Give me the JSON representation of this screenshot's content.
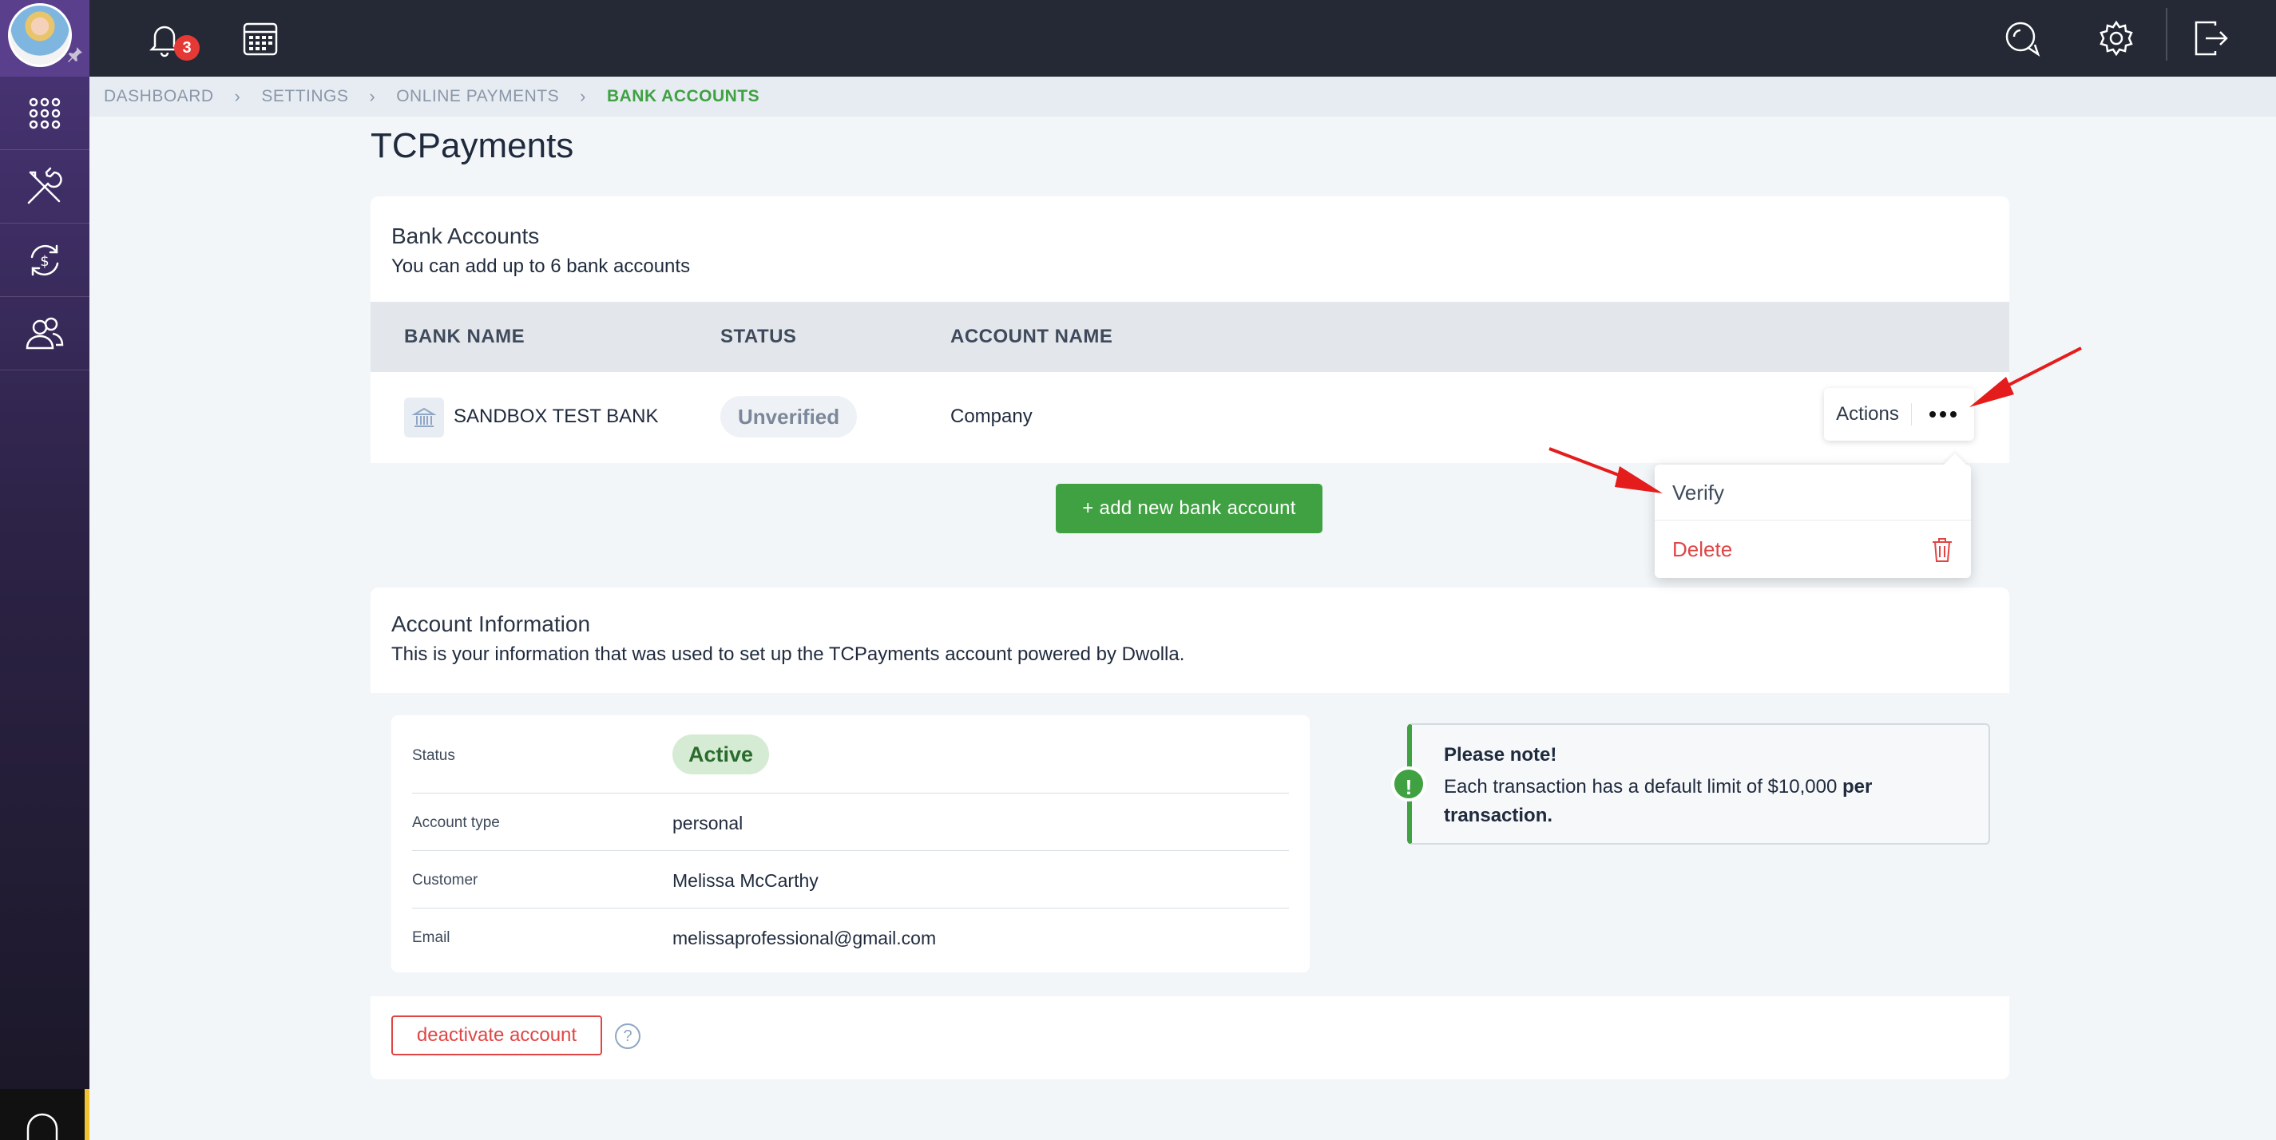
{
  "topbar": {
    "notification_count": "3"
  },
  "breadcrumb": [
    "DASHBOARD",
    "SETTINGS",
    "ONLINE PAYMENTS",
    "BANK ACCOUNTS"
  ],
  "page_title": "TCPayments",
  "bank_accounts": {
    "title": "Bank Accounts",
    "subtitle": "You can add up to 6 bank accounts",
    "columns": [
      "BANK NAME",
      "STATUS",
      "ACCOUNT NAME"
    ],
    "rows": [
      {
        "bank_name": "SANDBOX TEST BANK",
        "status": "Unverified",
        "account_name": "Company"
      }
    ],
    "actions_label": "Actions",
    "add_button": "+ add new bank account",
    "dropdown": {
      "verify": "Verify",
      "delete": "Delete"
    }
  },
  "account_info": {
    "title": "Account Information",
    "subtitle": "This is your information that was used to set up the TCPayments account powered by Dwolla.",
    "fields": [
      {
        "key": "Status",
        "value": "Active"
      },
      {
        "key": "Account type",
        "value": "personal"
      },
      {
        "key": "Customer",
        "value": "Melissa McCarthy"
      },
      {
        "key": "Email",
        "value": "melissaprofessional@gmail.com"
      }
    ],
    "note_title": "Please note!",
    "note_text": "Each transaction has a default limit of $10,000",
    "note_bold": "per transaction.",
    "deactivate_button": "deactivate account",
    "help_glyph": "?"
  },
  "colors": {
    "accent_green": "#3fa142",
    "danger_red": "#e04545",
    "topbar": "#252935",
    "sidebar": "#2d2347"
  },
  "icons": [
    "pin-icon",
    "apps-grid-icon",
    "tools-icon",
    "payments-icon",
    "users-icon",
    "headset-icon",
    "bell-icon",
    "calendar-icon",
    "chat-icon",
    "gear-icon",
    "logout-icon",
    "bank-icon",
    "trash-icon",
    "info-exclamation-icon",
    "help-icon"
  ]
}
